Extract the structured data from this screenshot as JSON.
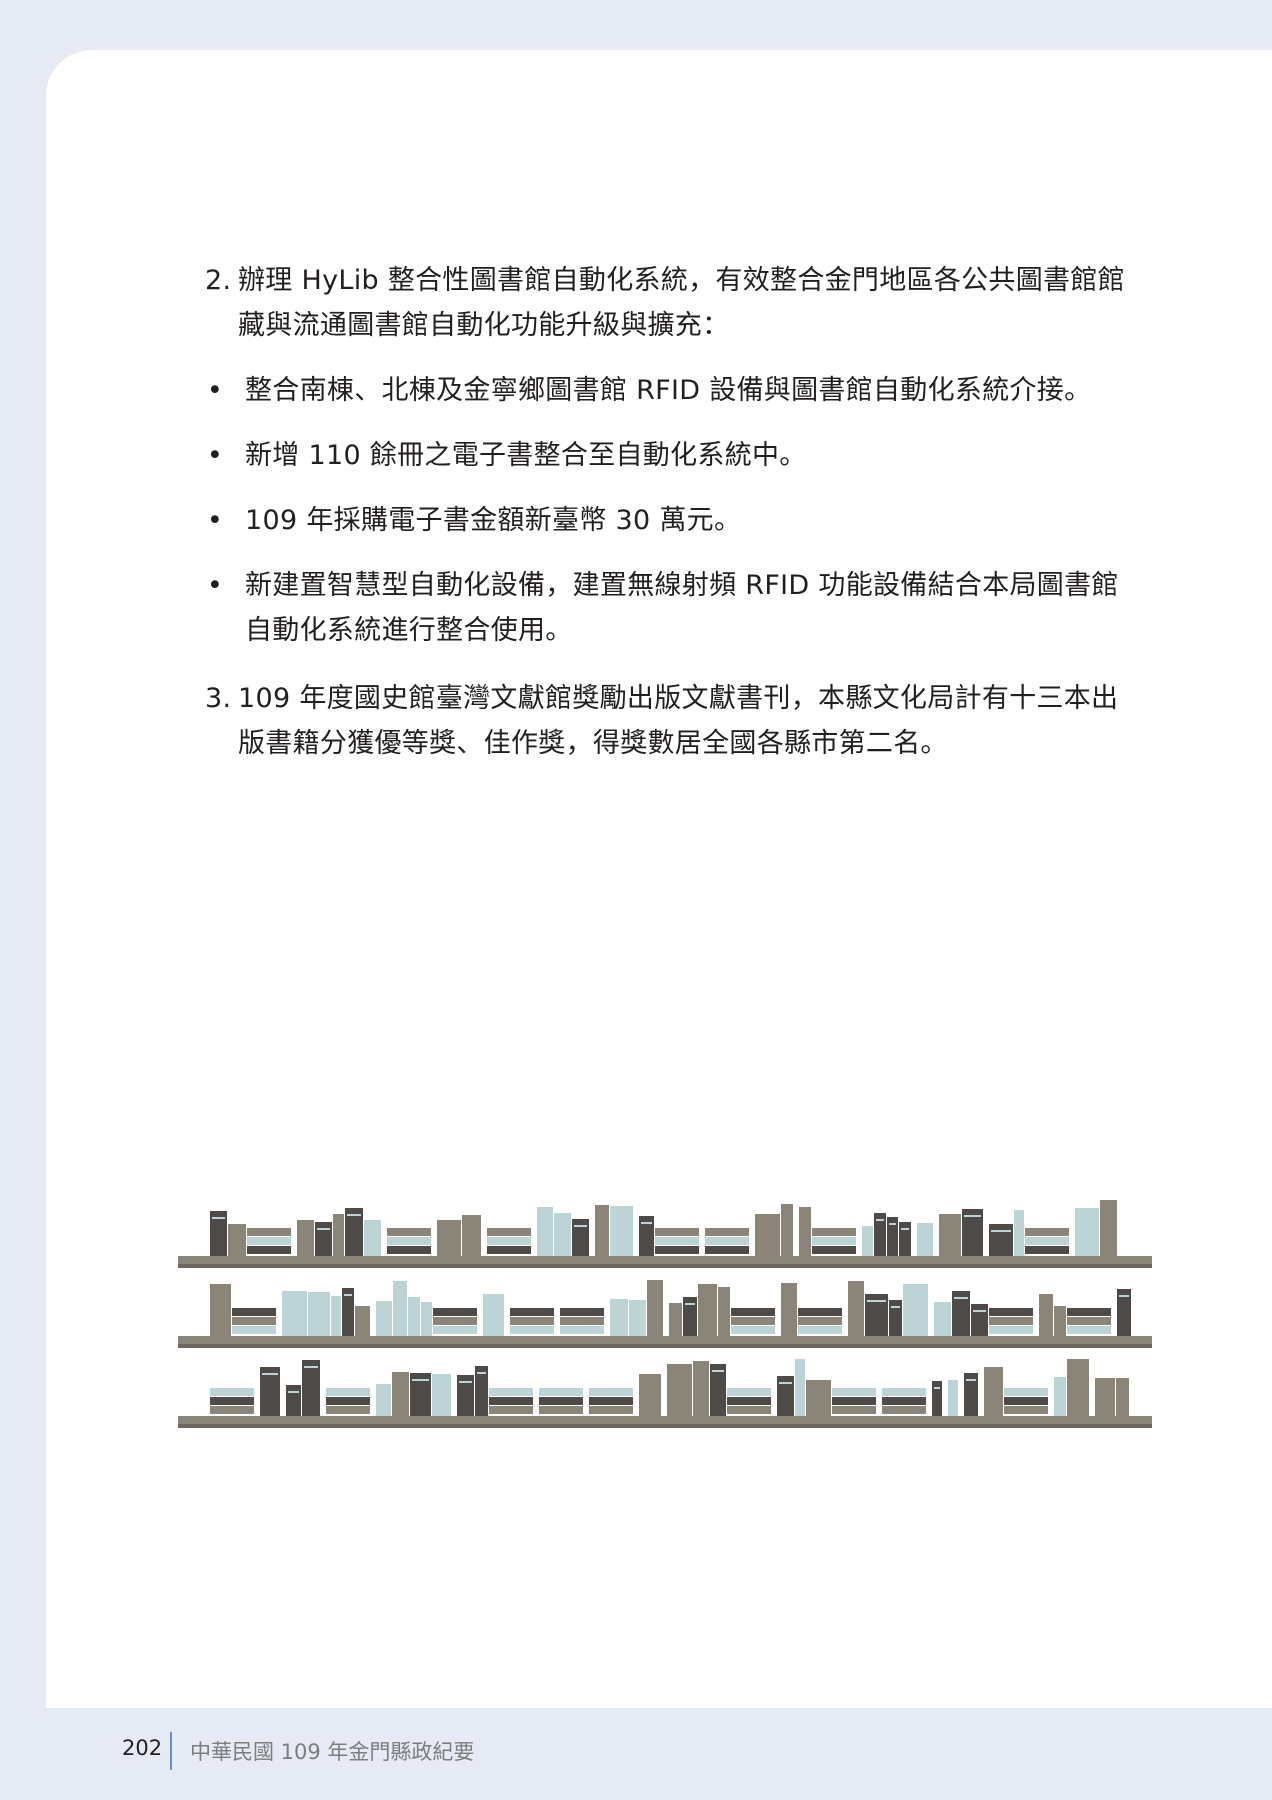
{
  "items": [
    {
      "marker": "2.",
      "line1": "辦理 HyLib 整合性圖書館自動化系統，有效整合金門地區各公共圖書館館",
      "line2": "藏與流通圖書館自動化功能升級與擴充："
    },
    {
      "bullet": "•",
      "text": "整合南棟、北棟及金寧鄉圖書館 RFID 設備與圖書館自動化系統介接。"
    },
    {
      "bullet": "•",
      "text": "新增 110 餘冊之電子書整合至自動化系統中。"
    },
    {
      "bullet": "•",
      "text": "109 年採購電子書金額新臺幣 30 萬元。"
    },
    {
      "bullet": "•",
      "text": "新建置智慧型自動化設備，建置無線射頻 RFID 功能設備結合本局圖書館",
      "text2": "自動化系統進行整合使用。"
    },
    {
      "marker": "3.",
      "line1": "109 年度國史館臺灣文獻館獎勵出版文獻書刊，本縣文化局計有十三本出",
      "line2": "版書籍分獲優等獎、佳作獎，得獎數居全國各縣市第二名。"
    }
  ],
  "footer": {
    "page_number": "202",
    "title": "中華民國 109 年金門縣政紀要"
  },
  "colors": {
    "shelf": "#8a8578",
    "book_dark": "#4d4a47",
    "book_light": "#bcd4d6",
    "book_taupe": "#8b8479",
    "background_tint": "#e6eaf4",
    "footer_accent": "#6f8fb8"
  }
}
